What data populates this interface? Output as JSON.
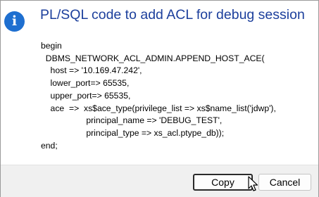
{
  "dialog": {
    "icon": "info-icon",
    "icon_glyph": "i",
    "title": "PL/SQL code to add ACL for debug session"
  },
  "code": {
    "lines": [
      "begin",
      "  DBMS_NETWORK_ACL_ADMIN.APPEND_HOST_ACE(",
      "    host => '10.169.47.242',",
      "    lower_port=> 65535,",
      "    upper_port=> 65535,",
      "    ace  =>  xs$ace_type(privilege_list => xs$name_list('jdwp'),",
      "                   principal_name => 'DEBUG_TEST',",
      "                   principal_type => xs_acl.ptype_db));",
      "end;"
    ]
  },
  "buttons": {
    "copy_label": "Copy",
    "cancel_label": "Cancel"
  },
  "colors": {
    "title": "#1c3f9c",
    "icon_bg": "#1e6fd0",
    "footer_bg": "#f0f0f0"
  },
  "cursor": "arrow-pointer-icon"
}
